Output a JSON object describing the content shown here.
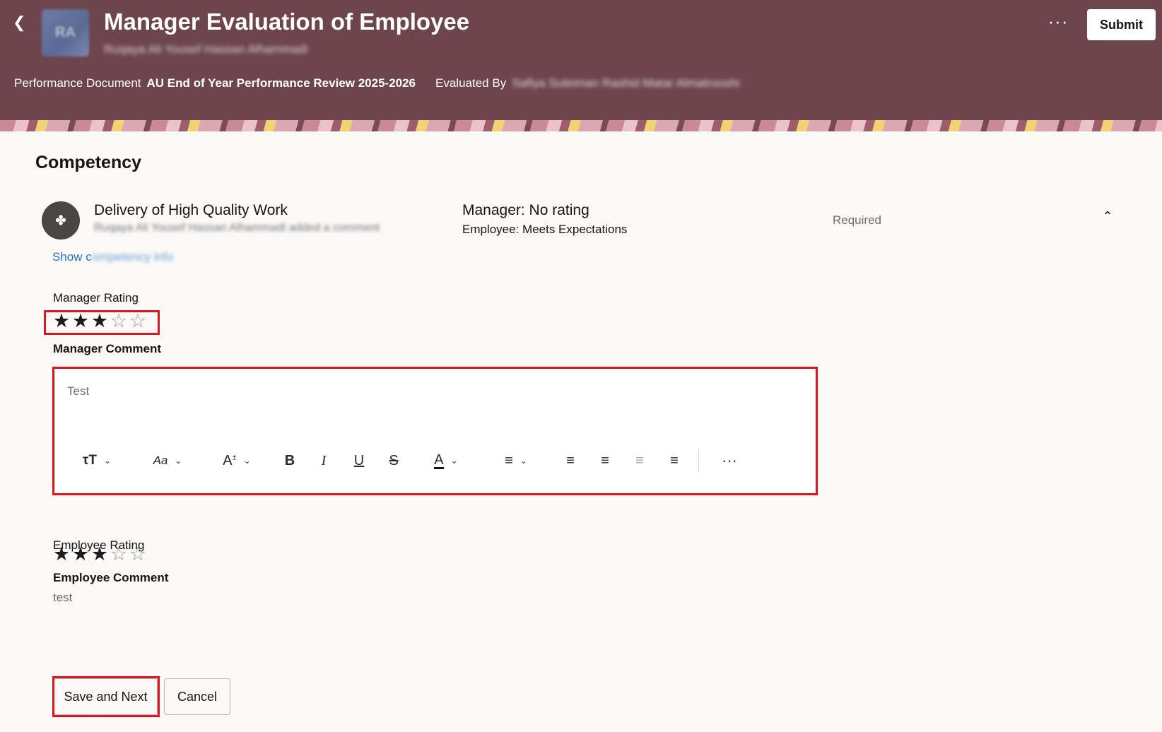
{
  "header": {
    "title": "Manager Evaluation of Employee",
    "avatar_initials": "RA",
    "employee_name": "Ruqaya Ali Yousef Hassan Alhammadi",
    "back_icon": "chevron-left-icon",
    "more_icon": "ellipsis-icon",
    "submit_label": "Submit",
    "performance_document_label": "Performance Document",
    "performance_document_value": "AU End of Year Performance Review 2025-2026",
    "evaluated_by_label": "Evaluated By",
    "evaluated_by_value": "Safiya Suleiman Rashid Matar Almatrooshi",
    "background_color": "#6d454d"
  },
  "competency": {
    "section_title": "Competency",
    "icon_glyph": "✤",
    "name": "Delivery of High Quality Work",
    "activity": "Ruqaya Ali Yousef Hassan Alhammadi added a comment",
    "manager_status": "Manager: No rating",
    "employee_status": "Employee: Meets Expectations",
    "required_label": "Required",
    "collapse_icon": "chevron-up-icon",
    "show_link_prefix": "Show c",
    "show_link_rest": "ompetency info",
    "manager_rating_label": "Manager Rating",
    "manager_rating_value": 3,
    "manager_rating_max": 5,
    "manager_comment_label": "Manager Comment",
    "manager_comment_text": "Test",
    "employee_rating_label": "Employee Rating",
    "employee_rating_value": 3,
    "employee_rating_max": 5,
    "employee_comment_label": "Employee Comment",
    "employee_comment_text": "test"
  },
  "editor_toolbar": {
    "items": [
      "text-size-icon",
      "font-family-icon",
      "superscript-icon",
      "bold-icon",
      "italic-icon",
      "underline-icon",
      "strikethrough-icon",
      "text-color-icon",
      "align-left-icon",
      "bulleted-list-icon",
      "numbered-list-icon",
      "outdent-icon",
      "indent-icon",
      "more-options-icon"
    ]
  },
  "actions": {
    "save_next_label": "Save and Next",
    "cancel_label": "Cancel"
  },
  "colors": {
    "accent_highlight": "#d7161d",
    "link": "#2a6fb1"
  }
}
